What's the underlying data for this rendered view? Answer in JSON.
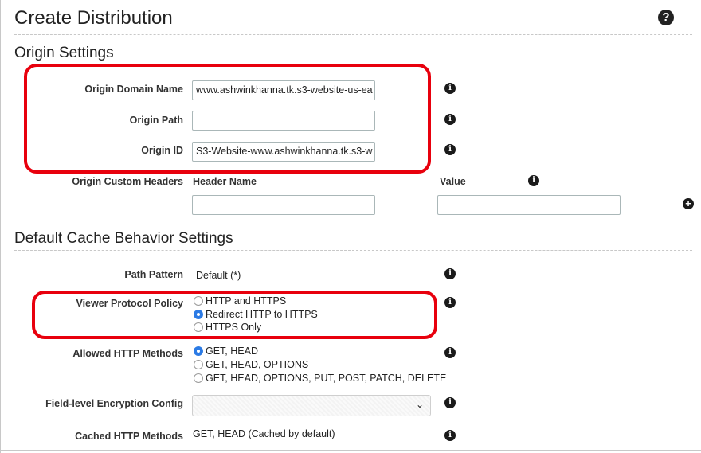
{
  "page": {
    "title": "Create Distribution"
  },
  "origin_settings": {
    "title": "Origin Settings",
    "fields": {
      "domain_name": {
        "label": "Origin Domain Name",
        "value": "www.ashwinkhanna.tk.s3-website-us-ea"
      },
      "path": {
        "label": "Origin Path",
        "value": ""
      },
      "id": {
        "label": "Origin ID",
        "value": "S3-Website-www.ashwinkhanna.tk.s3-w"
      }
    },
    "custom_headers": {
      "label": "Origin Custom Headers",
      "header_name_col": "Header Name",
      "value_col": "Value",
      "header_name_value": "",
      "value_value": ""
    }
  },
  "cache_behavior": {
    "title": "Default Cache Behavior Settings",
    "path_pattern": {
      "label": "Path Pattern",
      "value": "Default (*)"
    },
    "viewer_protocol": {
      "label": "Viewer Protocol Policy",
      "options": [
        "HTTP and HTTPS",
        "Redirect HTTP to HTTPS",
        "HTTPS Only"
      ],
      "selected": "Redirect HTTP to HTTPS"
    },
    "allowed_methods": {
      "label": "Allowed HTTP Methods",
      "options": [
        "GET, HEAD",
        "GET, HEAD, OPTIONS",
        "GET, HEAD, OPTIONS, PUT, POST, PATCH, DELETE"
      ],
      "selected": "GET, HEAD"
    },
    "field_level_encryption": {
      "label": "Field-level Encryption Config",
      "value": ""
    },
    "cached_methods": {
      "label": "Cached HTTP Methods",
      "value": "GET, HEAD (Cached by default)"
    }
  },
  "icons": {
    "help": "question-circle-icon",
    "info": "info-icon",
    "add": "plus-circle-icon",
    "dropdown": "chevron-down-icon"
  },
  "colors": {
    "highlight": "#e8000d",
    "radio_selected": "#2c7be5"
  }
}
